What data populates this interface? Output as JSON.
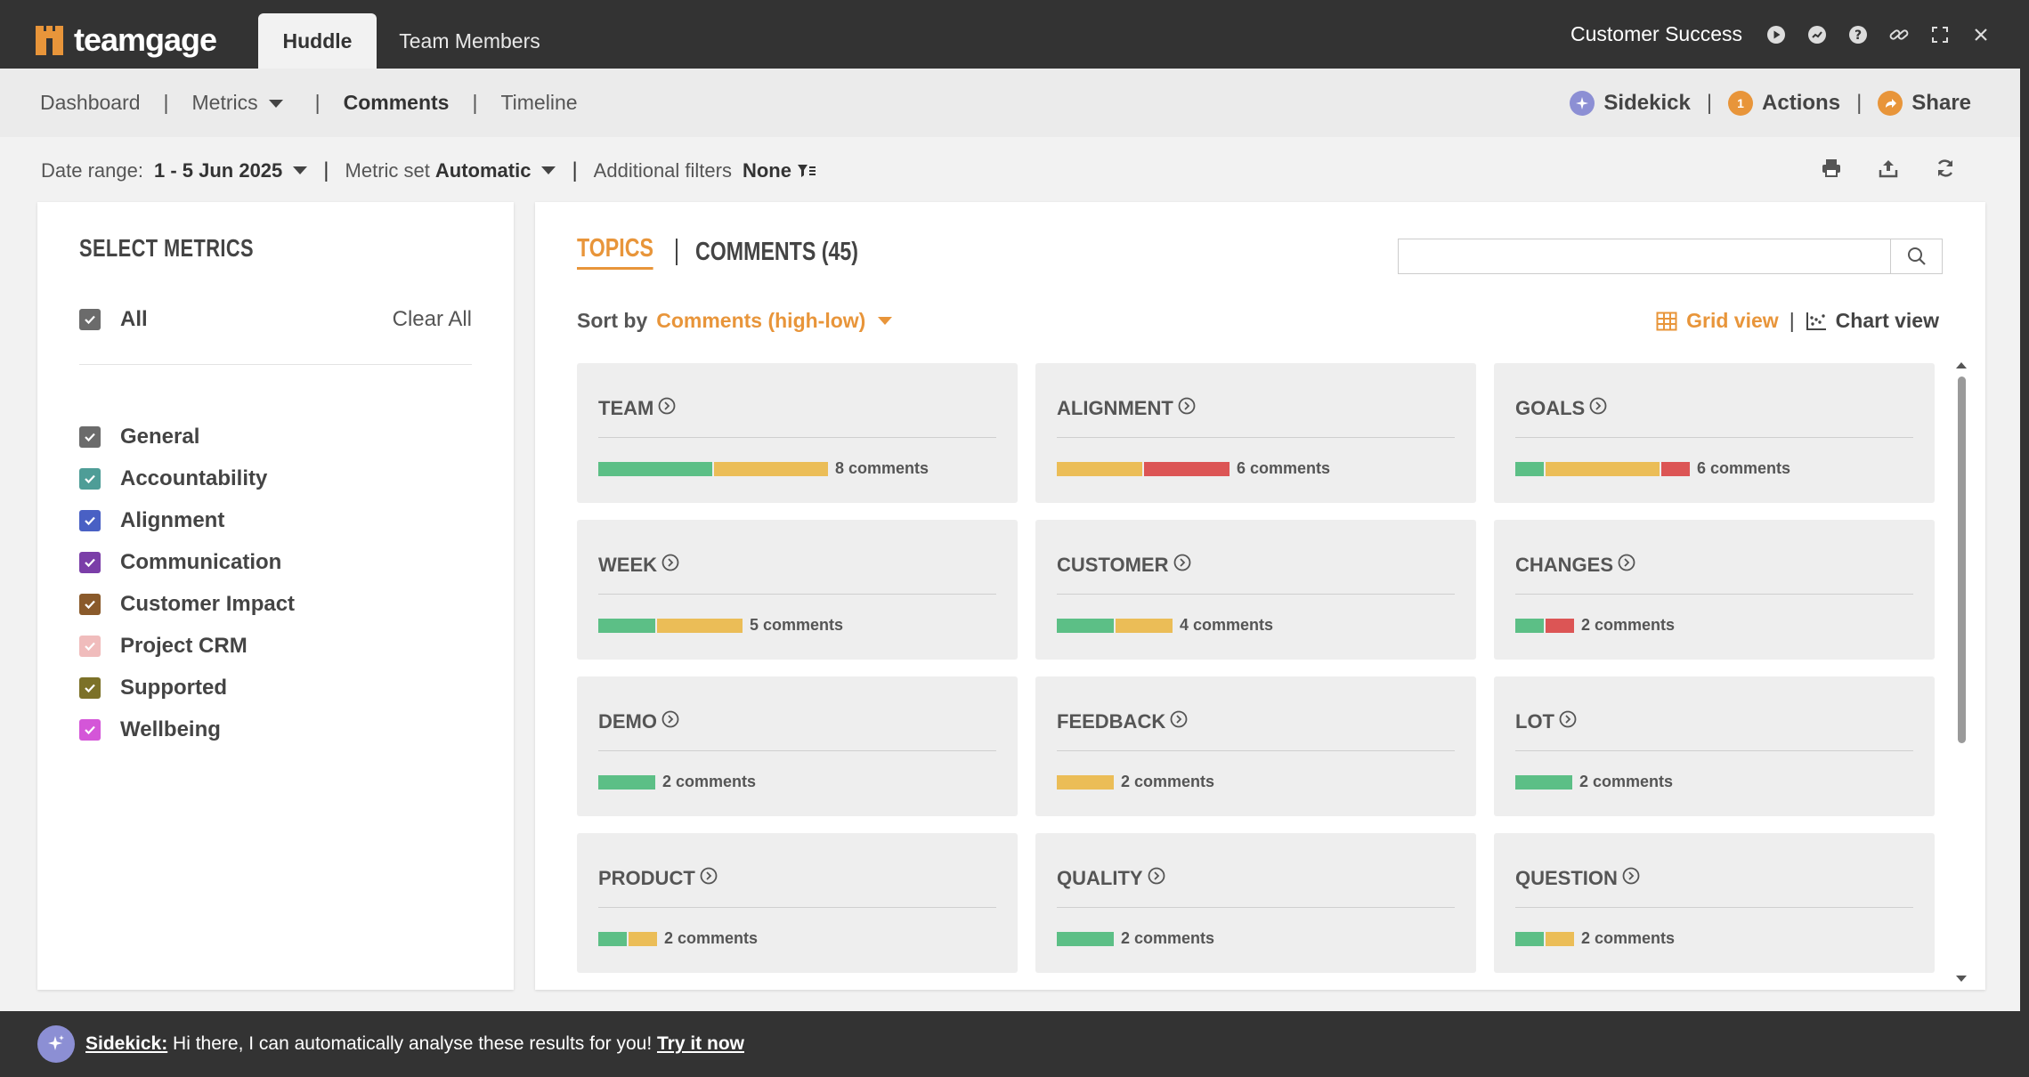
{
  "app": {
    "logo_text": "teamgage"
  },
  "topbar": {
    "tabs": [
      {
        "label": "Huddle",
        "active": true
      },
      {
        "label": "Team Members",
        "active": false
      }
    ],
    "context_label": "Customer Success",
    "icons": [
      "play-icon",
      "chat-icon",
      "help-icon",
      "link-icon",
      "fullscreen-icon",
      "close-icon"
    ]
  },
  "nav": {
    "items": [
      {
        "label": "Dashboard",
        "active": false
      },
      {
        "label": "Metrics",
        "active": false,
        "dropdown": true
      },
      {
        "label": "Comments",
        "active": true
      },
      {
        "label": "Timeline",
        "active": false
      }
    ],
    "sidekick_label": "Sidekick",
    "actions_label": "Actions",
    "actions_badge": "1",
    "share_label": "Share"
  },
  "filters": {
    "date_range_label": "Date range:",
    "date_range_value": "1 - 5 Jun 2025",
    "metric_set_label": "Metric set",
    "metric_set_value": "Automatic",
    "additional_label": "Additional filters",
    "additional_value": "None"
  },
  "metrics_panel": {
    "title": "SELECT METRICS",
    "all_label": "All",
    "clear_all_label": "Clear All",
    "items": [
      {
        "label": "General",
        "color": "#6b6b6b"
      },
      {
        "label": "Accountability",
        "color": "#4e9d97"
      },
      {
        "label": "Alignment",
        "color": "#4960c4"
      },
      {
        "label": "Communication",
        "color": "#7b3ea8"
      },
      {
        "label": "Customer Impact",
        "color": "#8a5a2b"
      },
      {
        "label": "Project CRM",
        "color": "#f0bcbc"
      },
      {
        "label": "Supported",
        "color": "#7c7128"
      },
      {
        "label": "Wellbeing",
        "color": "#d456d8"
      }
    ]
  },
  "main": {
    "tab_topics": "TOPICS",
    "tab_comments": "COMMENTS (45)",
    "search_placeholder": "",
    "sort_label": "Sort by",
    "sort_value": "Comments (high-low)",
    "grid_view_label": "Grid view",
    "chart_view_label": "Chart view",
    "colors": {
      "positive": "#5cbf86",
      "neutral": "#ebbd57",
      "negative": "#dc5555",
      "accent": "#e8953a"
    },
    "cards": [
      {
        "title": "TEAM",
        "count_label": "8 comments",
        "segments": [
          {
            "type": "positive",
            "value": 4
          },
          {
            "type": "neutral",
            "value": 4
          }
        ]
      },
      {
        "title": "ALIGNMENT",
        "count_label": "6 comments",
        "segments": [
          {
            "type": "neutral",
            "value": 3
          },
          {
            "type": "negative",
            "value": 3
          }
        ]
      },
      {
        "title": "GOALS",
        "count_label": "6 comments",
        "segments": [
          {
            "type": "positive",
            "value": 1
          },
          {
            "type": "neutral",
            "value": 4
          },
          {
            "type": "negative",
            "value": 1
          }
        ]
      },
      {
        "title": "WEEK",
        "count_label": "5 comments",
        "segments": [
          {
            "type": "positive",
            "value": 2
          },
          {
            "type": "neutral",
            "value": 3
          }
        ]
      },
      {
        "title": "CUSTOMER",
        "count_label": "4 comments",
        "segments": [
          {
            "type": "positive",
            "value": 2
          },
          {
            "type": "neutral",
            "value": 2
          }
        ]
      },
      {
        "title": "CHANGES",
        "count_label": "2 comments",
        "segments": [
          {
            "type": "positive",
            "value": 1
          },
          {
            "type": "negative",
            "value": 1
          }
        ]
      },
      {
        "title": "DEMO",
        "count_label": "2 comments",
        "segments": [
          {
            "type": "positive",
            "value": 2
          }
        ]
      },
      {
        "title": "FEEDBACK",
        "count_label": "2 comments",
        "segments": [
          {
            "type": "neutral",
            "value": 2
          }
        ]
      },
      {
        "title": "LOT",
        "count_label": "2 comments",
        "segments": [
          {
            "type": "positive",
            "value": 2
          }
        ]
      },
      {
        "title": "PRODUCT",
        "count_label": "2 comments",
        "segments": [
          {
            "type": "positive",
            "value": 1
          },
          {
            "type": "neutral",
            "value": 1
          }
        ]
      },
      {
        "title": "QUALITY",
        "count_label": "2 comments",
        "segments": [
          {
            "type": "positive",
            "value": 2
          }
        ]
      },
      {
        "title": "QUESTION",
        "count_label": "2 comments",
        "segments": [
          {
            "type": "positive",
            "value": 1
          },
          {
            "type": "neutral",
            "value": 1
          }
        ]
      }
    ]
  },
  "bottom": {
    "sidekick_label": "Sidekick:",
    "message": " Hi there, I can automatically analyse these results for you! ",
    "cta": "Try it now"
  }
}
